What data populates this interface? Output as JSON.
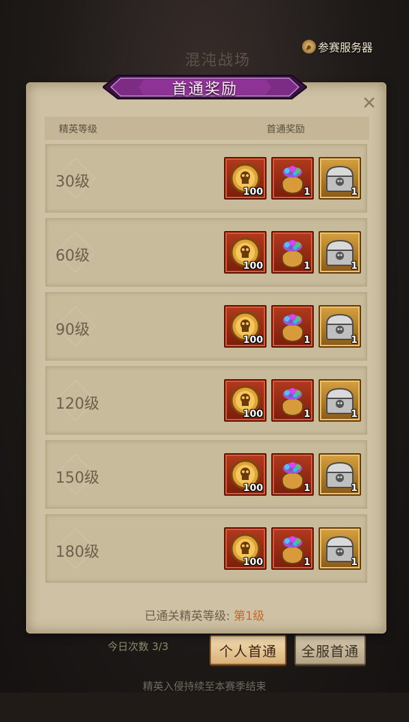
{
  "background": {
    "title": "混沌战场",
    "server_button": "参赛服务器",
    "today_count": "今日次数 3/3",
    "buttons": {
      "personal": "个人首通",
      "server": "全服首通"
    },
    "note": "精英入侵持续至本赛季结束"
  },
  "dialog": {
    "title": "首通奖励",
    "close_icon": "close-icon",
    "header": {
      "level_col": "精英等级",
      "reward_col": "首通奖励"
    },
    "rows": [
      {
        "level": "30级",
        "rewards": [
          {
            "icon": "skull-coin-icon",
            "qty": "100"
          },
          {
            "icon": "gem-bag-icon",
            "qty": "1"
          },
          {
            "icon": "silver-chest-icon",
            "qty": "1"
          }
        ]
      },
      {
        "level": "60级",
        "rewards": [
          {
            "icon": "skull-coin-icon",
            "qty": "100"
          },
          {
            "icon": "gem-bag-icon",
            "qty": "1"
          },
          {
            "icon": "silver-chest-icon",
            "qty": "1"
          }
        ]
      },
      {
        "level": "90级",
        "rewards": [
          {
            "icon": "skull-coin-icon",
            "qty": "100"
          },
          {
            "icon": "gem-bag-icon",
            "qty": "1"
          },
          {
            "icon": "silver-chest-icon",
            "qty": "1"
          }
        ]
      },
      {
        "level": "120级",
        "rewards": [
          {
            "icon": "skull-coin-icon",
            "qty": "100"
          },
          {
            "icon": "gem-bag-icon",
            "qty": "1"
          },
          {
            "icon": "silver-chest-icon",
            "qty": "1"
          }
        ]
      },
      {
        "level": "150级",
        "rewards": [
          {
            "icon": "skull-coin-icon",
            "qty": "100"
          },
          {
            "icon": "gem-bag-icon",
            "qty": "1"
          },
          {
            "icon": "silver-chest-icon",
            "qty": "1"
          }
        ]
      },
      {
        "level": "180级",
        "rewards": [
          {
            "icon": "skull-coin-icon",
            "qty": "100"
          },
          {
            "icon": "gem-bag-icon",
            "qty": "1"
          },
          {
            "icon": "silver-chest-icon",
            "qty": "1"
          }
        ]
      }
    ],
    "cleared_label": "已通关精英等级:",
    "cleared_value": "第1级"
  }
}
